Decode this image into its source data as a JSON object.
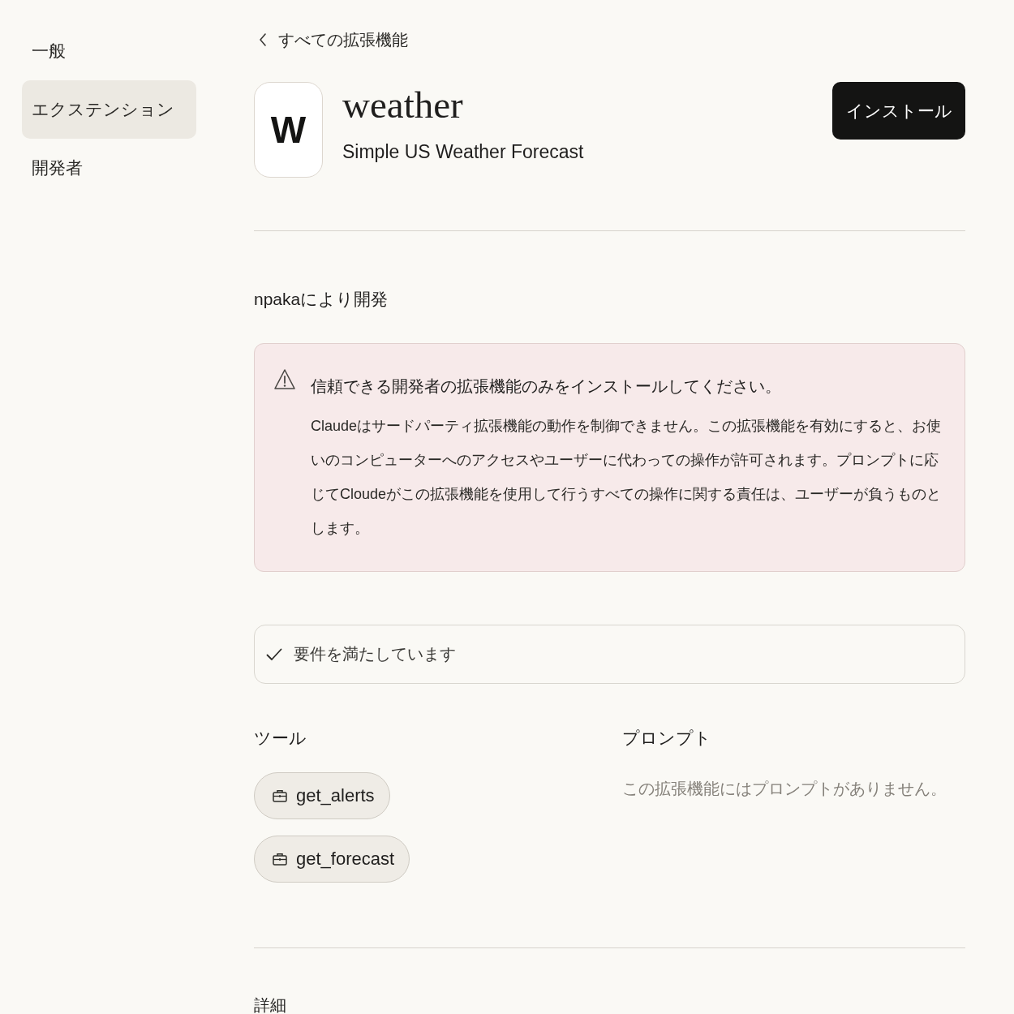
{
  "sidebar": {
    "items": [
      {
        "label": "一般",
        "selected": false
      },
      {
        "label": "エクステンション",
        "selected": true
      },
      {
        "label": "開発者",
        "selected": false
      }
    ]
  },
  "back_link": {
    "label": "すべての拡張機能"
  },
  "extension": {
    "icon_letter": "W",
    "name": "weather",
    "description": "Simple US Weather Forecast",
    "install_button": "インストール",
    "developer": "npakaにより開発"
  },
  "warning": {
    "title": "信頼できる開発者の拡張機能のみをインストールしてください。",
    "body": "Claudeはサードパーティ拡張機能の動作を制御できません。この拡張機能を有効にすると、お使いのコンピューターへのアクセスやユーザーに代わっての操作が許可されます。プロンプトに応じてCloudeがこの拡張機能を使用して行うすべての操作に関する責任は、ユーザーが負うものとします。"
  },
  "requirements": {
    "label": "要件を満たしています",
    "met": true
  },
  "tools": {
    "heading": "ツール",
    "items": [
      "get_alerts",
      "get_forecast"
    ]
  },
  "prompts": {
    "heading": "プロンプト",
    "empty_text": "この拡張機能にはプロンプトがありません。"
  },
  "details": {
    "heading": "詳細"
  }
}
